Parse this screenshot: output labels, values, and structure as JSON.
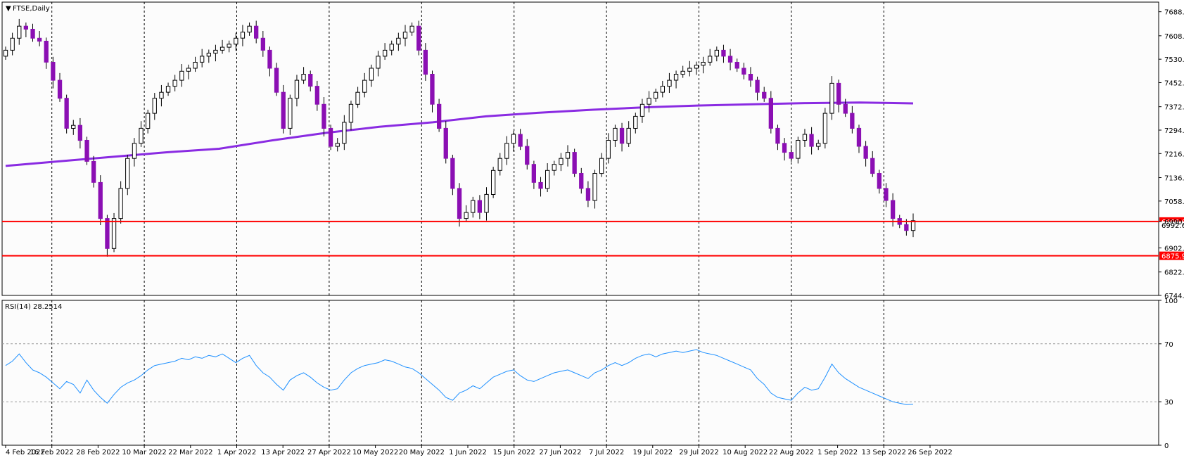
{
  "window": {
    "title": "FTSE,Daily",
    "indicator_title": "RSI(14) 28.2514"
  },
  "colors": {
    "bull": "#ffffff",
    "bear": "#8b0fb3",
    "ma": "#8a2be2",
    "rsi": "#1e90ff",
    "level": "#ff0000",
    "grid": "#000000"
  },
  "chart_data": [
    {
      "type": "candlestick",
      "title": "FTSE,Daily",
      "ylim": [
        6744,
        7720
      ],
      "y_ticks": [
        "7688.0",
        "7608.0",
        "7530.0",
        "7452.0",
        "7372.0",
        "7294.0",
        "7216.0",
        "7136.0",
        "7058.0",
        "6990.0",
        "6902.0",
        "6822.0",
        "6744.0"
      ],
      "x_ticks": [
        "4 Feb 2022",
        "16 Feb 2022",
        "28 Feb 2022",
        "10 Mar 2022",
        "22 Mar 2022",
        "1 Apr 2022",
        "13 Apr 2022",
        "27 Apr 2022",
        "10 May 2022",
        "20 May 2022",
        "1 Jun 2022",
        "15 Jun 2022",
        "27 Jun 2022",
        "7 Jul 2022",
        "19 Jul 2022",
        "29 Jul 2022",
        "10 Aug 2022",
        "22 Aug 2022",
        "1 Sep 2022",
        "13 Sep 2022",
        "26 Sep 2022"
      ],
      "levels": [
        {
          "value": 6990.0,
          "label": "6990.0"
        },
        {
          "value": 6875.9,
          "label": "6875.9"
        }
      ],
      "current_price_label": "6992.6",
      "moving_average": [
        7175,
        7190,
        7205,
        7220,
        7232,
        7260,
        7285,
        7305,
        7320,
        7340,
        7352,
        7362,
        7370,
        7376,
        7380,
        7384,
        7386,
        7383
      ],
      "closes": [
        7560,
        7600,
        7640,
        7630,
        7600,
        7590,
        7520,
        7460,
        7400,
        7300,
        7310,
        7260,
        7190,
        7120,
        7000,
        6900,
        7000,
        7100,
        7200,
        7250,
        7300,
        7350,
        7400,
        7420,
        7440,
        7460,
        7490,
        7500,
        7520,
        7540,
        7550,
        7560,
        7570,
        7580,
        7600,
        7620,
        7640,
        7600,
        7560,
        7500,
        7420,
        7300,
        7400,
        7460,
        7480,
        7440,
        7380,
        7300,
        7240,
        7250,
        7320,
        7380,
        7420,
        7460,
        7500,
        7540,
        7560,
        7580,
        7600,
        7620,
        7640,
        7560,
        7480,
        7380,
        7300,
        7200,
        7100,
        7000,
        7020,
        7060,
        7020,
        7080,
        7160,
        7200,
        7250,
        7280,
        7240,
        7180,
        7120,
        7100,
        7160,
        7180,
        7200,
        7220,
        7150,
        7100,
        7060,
        7150,
        7200,
        7260,
        7300,
        7250,
        7300,
        7340,
        7380,
        7400,
        7420,
        7440,
        7460,
        7480,
        7490,
        7500,
        7510,
        7520,
        7540,
        7560,
        7540,
        7520,
        7500,
        7480,
        7460,
        7420,
        7400,
        7300,
        7250,
        7220,
        7200,
        7260,
        7280,
        7240,
        7250,
        7350,
        7450,
        7380,
        7350,
        7300,
        7240,
        7200,
        7150,
        7100,
        7060,
        7000,
        6980,
        6960,
        6992.6
      ],
      "rsi_ylim": [
        0,
        100
      ],
      "rsi_ticks": [
        "100",
        "70",
        "30",
        "0"
      ],
      "rsi": [
        55,
        58,
        63,
        57,
        52,
        50,
        47,
        43,
        39,
        44,
        42,
        36,
        45,
        38,
        33,
        29,
        35,
        40,
        43,
        45,
        48,
        52,
        55,
        56,
        57,
        58,
        60,
        59,
        61,
        60,
        62,
        61,
        63,
        60,
        57,
        60,
        62,
        55,
        50,
        47,
        42,
        38,
        45,
        48,
        50,
        47,
        43,
        40,
        38,
        39,
        45,
        50,
        53,
        55,
        56,
        57,
        59,
        58,
        56,
        54,
        53,
        50,
        46,
        42,
        38,
        33,
        31,
        36,
        38,
        41,
        39,
        43,
        47,
        49,
        51,
        52,
        48,
        45,
        44,
        46,
        48,
        50,
        51,
        52,
        50,
        48,
        46,
        50,
        52,
        55,
        57,
        55,
        57,
        60,
        62,
        63,
        61,
        63,
        64,
        65,
        64,
        65,
        66,
        64,
        63,
        62,
        60,
        58,
        56,
        54,
        52,
        46,
        42,
        36,
        33,
        32,
        31,
        36,
        40,
        38,
        39,
        47,
        56,
        50,
        46,
        43,
        40,
        38,
        36,
        34,
        32,
        30,
        29,
        28,
        28.2514
      ]
    }
  ]
}
